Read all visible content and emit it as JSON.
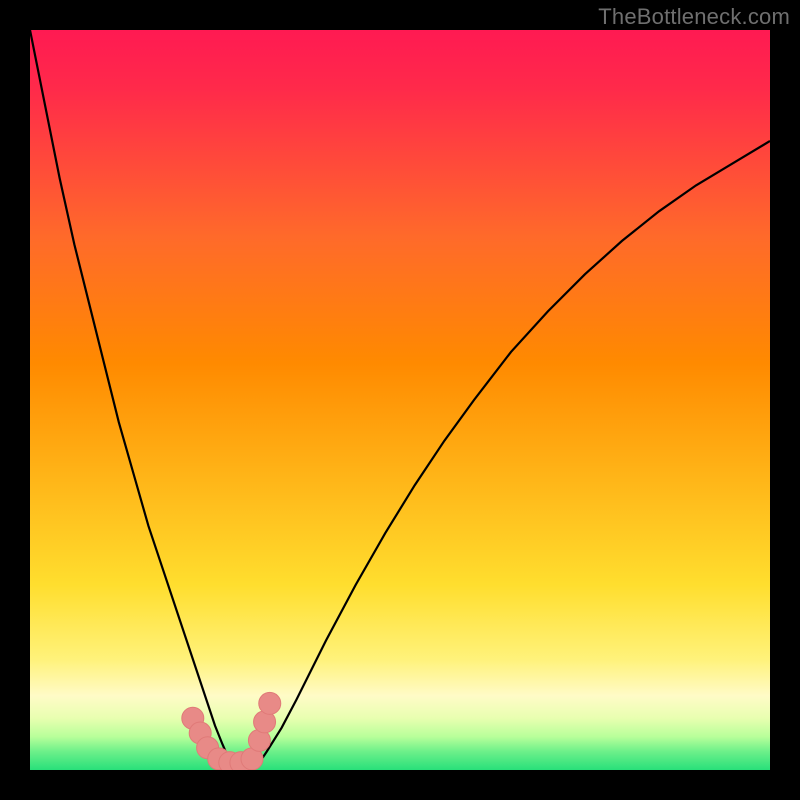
{
  "watermark": "TheBottleneck.com",
  "colors": {
    "black": "#000000",
    "gradient_top": "#ff1a52",
    "gradient_mid": "#ff8a00",
    "gradient_yellow": "#ffde2e",
    "gradient_pale": "#fffbc7",
    "gradient_green": "#28e07a",
    "curve": "#000000",
    "marker_fill": "#e88a87",
    "marker_stroke": "#e07a78"
  },
  "chart_data": {
    "type": "line",
    "title": "",
    "xlabel": "",
    "ylabel": "",
    "xlim": [
      0,
      100
    ],
    "ylim": [
      0,
      100
    ],
    "annotations": [
      "TheBottleneck.com"
    ],
    "description": "V-shaped curve plunging from top-left to a minimum near x≈27 (y≈0) then rising with decreasing slope toward top-right. Backdrop is a vertical red→orange→yellow→pale→green gradient; a few salmon marker dots sit near the curve bottom.",
    "series": [
      {
        "name": "curve",
        "x": [
          0,
          2,
          4,
          6,
          8,
          10,
          12,
          14,
          16,
          18,
          20,
          22,
          24,
          25,
          26,
          27,
          28,
          29,
          30,
          31,
          32,
          34,
          36,
          38,
          40,
          44,
          48,
          52,
          56,
          60,
          65,
          70,
          75,
          80,
          85,
          90,
          95,
          100
        ],
        "y": [
          100,
          90,
          80,
          71,
          63,
          55,
          47,
          40,
          33,
          27,
          21,
          15,
          9,
          6,
          3.5,
          1.2,
          0.2,
          0.0,
          0.2,
          1.0,
          2.5,
          5.7,
          9.5,
          13.5,
          17.5,
          25,
          32,
          38.5,
          44.5,
          50,
          56.5,
          62,
          67,
          71.5,
          75.5,
          79,
          82,
          85
        ]
      }
    ],
    "markers": [
      {
        "x": 22.0,
        "y": 7.0
      },
      {
        "x": 23.0,
        "y": 5.0
      },
      {
        "x": 24.0,
        "y": 3.0
      },
      {
        "x": 25.5,
        "y": 1.5
      },
      {
        "x": 27.0,
        "y": 1.0
      },
      {
        "x": 28.5,
        "y": 1.0
      },
      {
        "x": 30.0,
        "y": 1.5
      },
      {
        "x": 31.0,
        "y": 4.0
      },
      {
        "x": 31.7,
        "y": 6.5
      },
      {
        "x": 32.4,
        "y": 9.0
      }
    ]
  }
}
